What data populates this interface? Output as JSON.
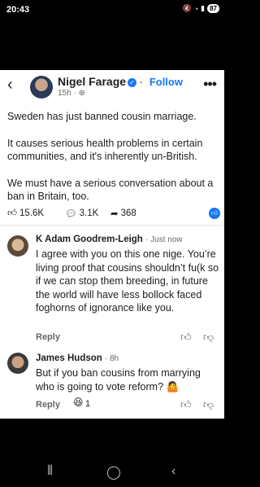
{
  "status": {
    "time": "20:43",
    "battery": "87"
  },
  "post": {
    "author": "Nigel Farage",
    "follow_label": "Follow",
    "time": "15h",
    "paragraphs": [
      "Sweden has just banned cousin marriage.",
      "It causes serious health problems in certain communities, and it's inherently un-British.",
      "We must have a serious conversation about a ban in Britain, too."
    ],
    "likes": "15.6K",
    "comments": "3.1K",
    "shares": "368"
  },
  "comments": [
    {
      "name": "K Adam Goodrem-Leigh",
      "time": "Just now",
      "text": "I agree with you on this one nige. You’re living proof that cousins shouldn’t fu(k so if we can stop them breeding, in future the world will have less bollock faced foghorns of ignorance like you.",
      "reply_label": "Reply"
    },
    {
      "name": "James Hudson",
      "time": "8h",
      "text": "But if you ban cousins from marrying who is going to vote reform? 🤷",
      "reply_label": "Reply",
      "reaction_count": "1"
    }
  ],
  "colors": {
    "accent": "#1877f2",
    "secondary_text": "#65676b"
  }
}
